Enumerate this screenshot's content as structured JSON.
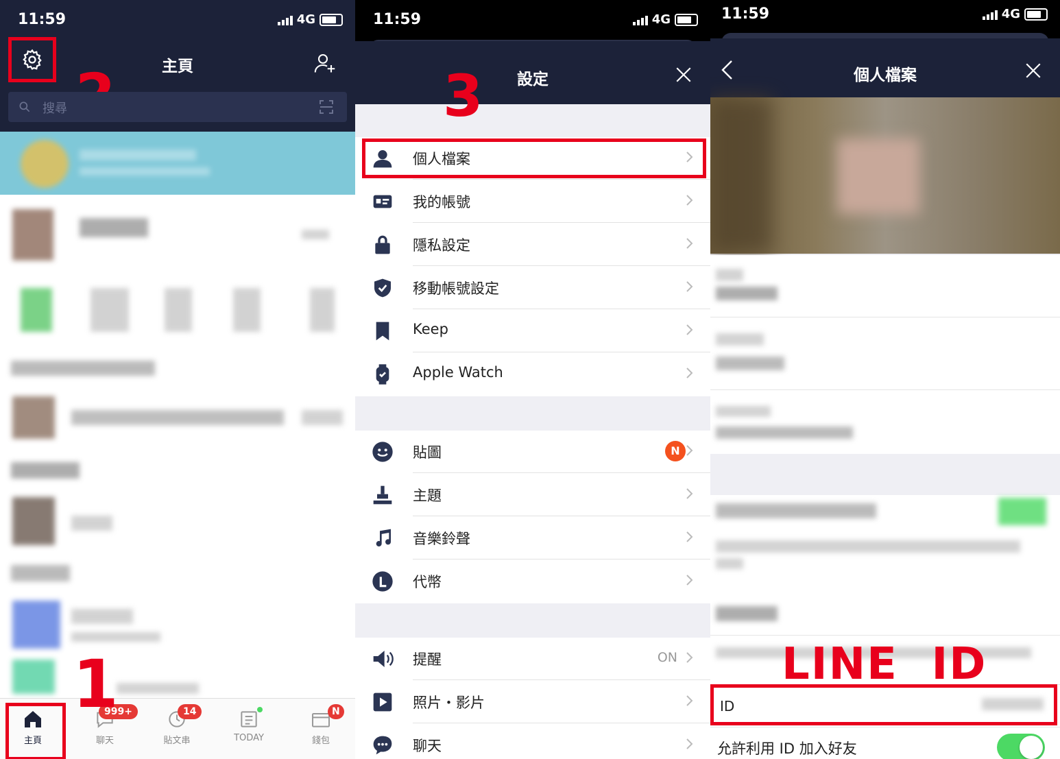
{
  "status_bar": {
    "time": "11:59",
    "network": "4G"
  },
  "panel1": {
    "title": "主頁",
    "search_placeholder": "搜尋",
    "step_gear": "2",
    "step_home": "1",
    "tabs": [
      {
        "label": "主頁",
        "badge": ""
      },
      {
        "label": "聊天",
        "badge": "999+"
      },
      {
        "label": "貼文串",
        "badge": "14"
      },
      {
        "label": "TODAY",
        "badge": ""
      },
      {
        "label": "錢包",
        "badge": "N"
      }
    ]
  },
  "panel2": {
    "title": "設定",
    "step": "3",
    "group1": [
      {
        "label": "個人檔案",
        "icon": "person-icon"
      },
      {
        "label": "我的帳號",
        "icon": "id-card-icon"
      },
      {
        "label": "隱私設定",
        "icon": "lock-icon"
      },
      {
        "label": "移動帳號設定",
        "icon": "shield-icon"
      },
      {
        "label": "Keep",
        "icon": "bookmark-icon"
      },
      {
        "label": "Apple Watch",
        "icon": "watch-icon"
      }
    ],
    "group2": [
      {
        "label": "貼圖",
        "icon": "smiley-icon",
        "badge": "N"
      },
      {
        "label": "主題",
        "icon": "brush-icon"
      },
      {
        "label": "音樂鈴聲",
        "icon": "music-icon"
      },
      {
        "label": "代幣",
        "icon": "coin-icon"
      }
    ],
    "group3": [
      {
        "label": "提醒",
        "icon": "speaker-icon",
        "value": "ON"
      },
      {
        "label": "照片・影片",
        "icon": "play-icon"
      },
      {
        "label": "聊天",
        "icon": "chat-icon"
      }
    ]
  },
  "panel3": {
    "title": "個人檔案",
    "annotation": "LINE  ID",
    "id_label": "ID",
    "allow_label": "允許利用 ID 加入好友",
    "allow_toggle": true
  },
  "colors": {
    "nav": "#1c2239",
    "highlight": "#e8001c",
    "toggle_on": "#4cd964"
  }
}
